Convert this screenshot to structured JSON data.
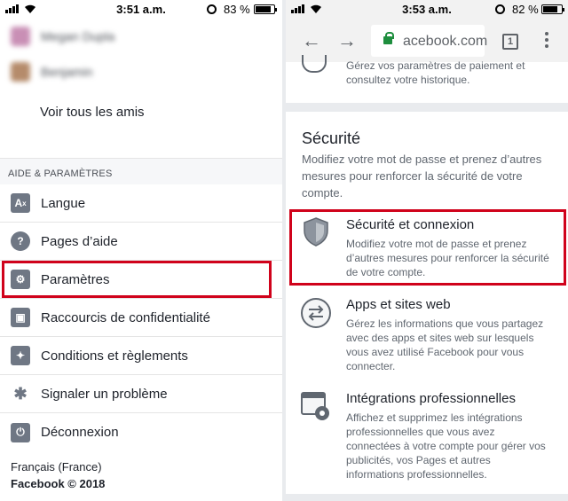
{
  "left": {
    "status": {
      "time": "3:51 a.m.",
      "battery": "83 %",
      "battery_level": 0.83
    },
    "friends": [
      "Megan Dupla",
      "Benjamin"
    ],
    "see_all": "Voir tous les amis",
    "section_header": "AIDE & PARAMÈTRES",
    "menu": [
      {
        "label": "Langue",
        "icon": "translate-icon",
        "glyph": "A⁄"
      },
      {
        "label": "Pages d’aide",
        "icon": "help-icon",
        "glyph": "?"
      },
      {
        "label": "Paramètres",
        "icon": "gear-icon",
        "glyph": "⚙"
      },
      {
        "label": "Raccourcis de confidentialité",
        "icon": "privacy-lock-icon",
        "glyph": "🔒"
      },
      {
        "label": "Conditions et règlements",
        "icon": "terms-badge-icon",
        "glyph": "✦"
      },
      {
        "label": "Signaler un problème",
        "icon": "bug-icon",
        "glyph": "✱"
      },
      {
        "label": "Déconnexion",
        "icon": "power-icon",
        "glyph": "⏻"
      }
    ],
    "footer_language": "Français (France)",
    "footer_copyright": "Facebook © 2018"
  },
  "right": {
    "status": {
      "time": "3:53 a.m.",
      "battery": "82 %",
      "battery_level": 0.82
    },
    "url": "acebook.com",
    "tab_count": "1",
    "top_text": "Gérez vos paramètres de paiement et consultez votre historique.",
    "section_title": "Sécurité",
    "section_desc": "Modifiez votre mot de passe et prenez d’autres mesures pour renforcer la sécurité de votre compte.",
    "items": [
      {
        "title": "Sécurité et connexion",
        "desc": "Modifiez votre mot de passe et prenez d’autres mesures pour renforcer la sécurité de votre compte.",
        "icon": "shield-icon"
      },
      {
        "title": "Apps et sites web",
        "desc": "Gérez les informations que vous partagez avec des apps et sites web sur lesquels vous avez utilisé Facebook pour vous connecter.",
        "icon": "apps-exchange-icon"
      },
      {
        "title": "Intégrations professionnelles",
        "desc": "Affichez et supprimez les intégrations professionnelles que vous avez connectées à votre compte pour gérer vos publicités, vos Pages et autres informations professionnelles.",
        "icon": "business-gear-icon"
      }
    ]
  },
  "colors": {
    "highlight": "#d0021b",
    "text": "#1d2129",
    "muted": "#606770",
    "icon": "#6f7784",
    "secure": "#1e8e3e"
  }
}
